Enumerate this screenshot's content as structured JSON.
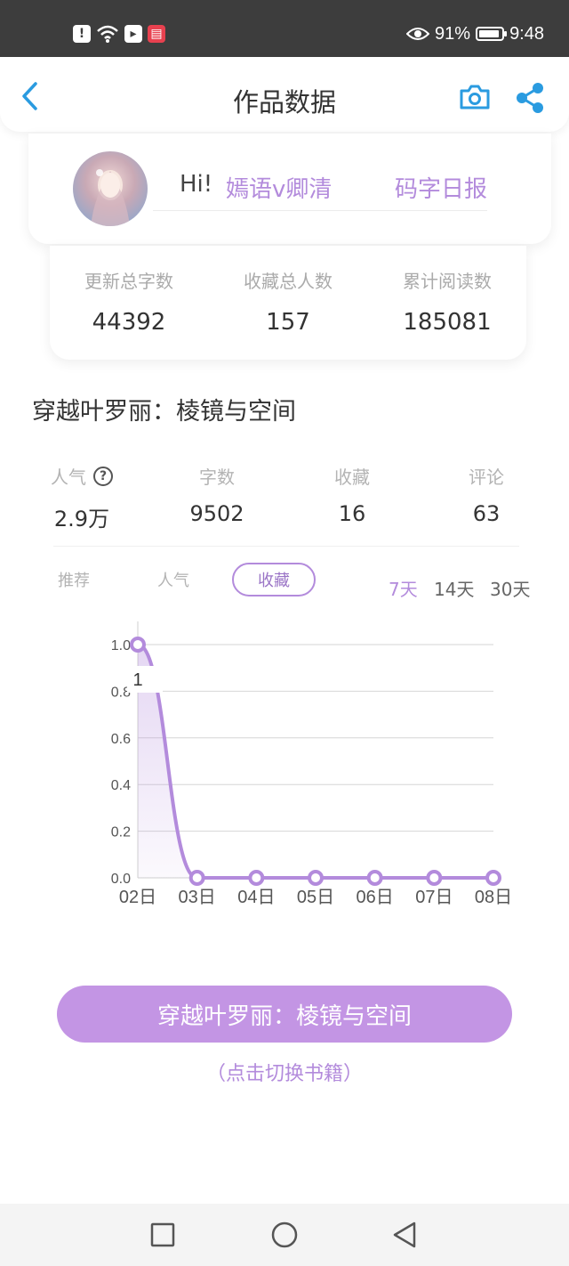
{
  "status_bar": {
    "left_icons": [
      "alert-icon",
      "wifi-icon",
      "app-notification-icon",
      "reader-app-icon"
    ],
    "battery": "91%",
    "battery_level": 0.91,
    "time": "9:48"
  },
  "header": {
    "title": "作品数据",
    "icons": [
      "back-arrow-icon",
      "camera-icon",
      "share-icon"
    ],
    "accent_color": "#2a9be0"
  },
  "profile": {
    "greeting": "Hi!",
    "username": "嫣语v卿清",
    "daily_report": "码字日报"
  },
  "totals": [
    {
      "label": "更新总字数",
      "value": "44392"
    },
    {
      "label": "收藏总人数",
      "value": "157"
    },
    {
      "label": "累计阅读数",
      "value": "185081"
    }
  ],
  "book": {
    "title": "穿越叶罗丽：棱镜与空间",
    "stats": [
      {
        "label": "人气",
        "value": "2.9万",
        "help": "?"
      },
      {
        "label": "字数",
        "value": "9502"
      },
      {
        "label": "收藏",
        "value": "16"
      },
      {
        "label": "评论",
        "value": "63"
      }
    ]
  },
  "tabs": [
    {
      "label": "推荐",
      "active": false
    },
    {
      "label": "人气",
      "active": false
    },
    {
      "label": "收藏",
      "active": true
    }
  ],
  "ranges": [
    {
      "label": "7天",
      "active": true
    },
    {
      "label": "14天",
      "active": false
    },
    {
      "label": "30天",
      "active": false
    }
  ],
  "chart_data": {
    "type": "area",
    "categories": [
      "02日",
      "03日",
      "04日",
      "05日",
      "06日",
      "07日",
      "08日"
    ],
    "values": [
      1,
      0,
      0,
      0,
      0,
      0,
      0
    ],
    "data_labels": [
      "1",
      "",
      "",
      "",
      "",
      "",
      ""
    ],
    "ylim": [
      0,
      1.0
    ],
    "y_ticks": [
      "0.0",
      "0.2",
      "0.4",
      "0.6",
      "0.8",
      "1.0"
    ],
    "grid": true,
    "color": "#b38bdc"
  },
  "switch": {
    "button_label": "穿越叶罗丽：棱镜与空间",
    "hint": "（点击切换书籍）"
  },
  "navbar": {
    "icons": [
      "recent-apps-icon",
      "home-icon",
      "back-icon"
    ]
  }
}
